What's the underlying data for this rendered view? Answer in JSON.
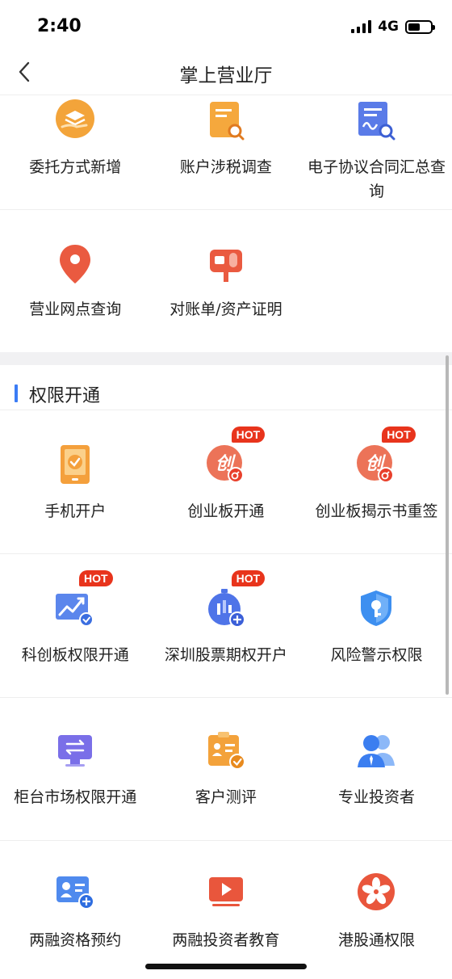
{
  "status": {
    "time": "2:40",
    "network": "4G"
  },
  "nav": {
    "title": "掌上营业厅"
  },
  "colors": {
    "accent": "#3b7cf5",
    "hot": "#e8341c",
    "orange": "#f29b38",
    "red": "#e8543f"
  },
  "top_services": [
    {
      "label": "委托方式新增",
      "icon": "hand-stack-icon"
    },
    {
      "label": "账户涉税调查",
      "icon": "document-search-icon"
    },
    {
      "label": "电子协议合同汇总查询",
      "icon": "contract-search-icon"
    },
    {
      "label": "营业网点查询",
      "icon": "location-pin-icon"
    },
    {
      "label": "对账单/资产证明",
      "icon": "mailbox-icon"
    }
  ],
  "section": {
    "title": "权限开通"
  },
  "permissions": [
    {
      "label": "手机开户",
      "icon": "mobile-check-icon",
      "badge": ""
    },
    {
      "label": "创业板开通",
      "icon": "chinext-icon",
      "badge": "HOT"
    },
    {
      "label": "创业板揭示书重签",
      "icon": "chinext-resign-icon",
      "badge": "HOT"
    },
    {
      "label": "科创板权限开通",
      "icon": "trend-chart-icon",
      "badge": "HOT"
    },
    {
      "label": "深圳股票期权开户",
      "icon": "stopwatch-add-icon",
      "badge": "HOT"
    },
    {
      "label": "风险警示权限",
      "icon": "shield-key-icon",
      "badge": ""
    },
    {
      "label": "柜台市场权限开通",
      "icon": "monitor-exchange-icon",
      "badge": ""
    },
    {
      "label": "客户测评",
      "icon": "clipboard-check-icon",
      "badge": ""
    },
    {
      "label": "专业投资者",
      "icon": "users-icon",
      "badge": ""
    },
    {
      "label": "两融资格预约",
      "icon": "id-card-add-icon",
      "badge": ""
    },
    {
      "label": "两融投资者教育",
      "icon": "video-play-icon",
      "badge": ""
    },
    {
      "label": "港股通权限",
      "icon": "hk-flower-icon",
      "badge": ""
    }
  ]
}
